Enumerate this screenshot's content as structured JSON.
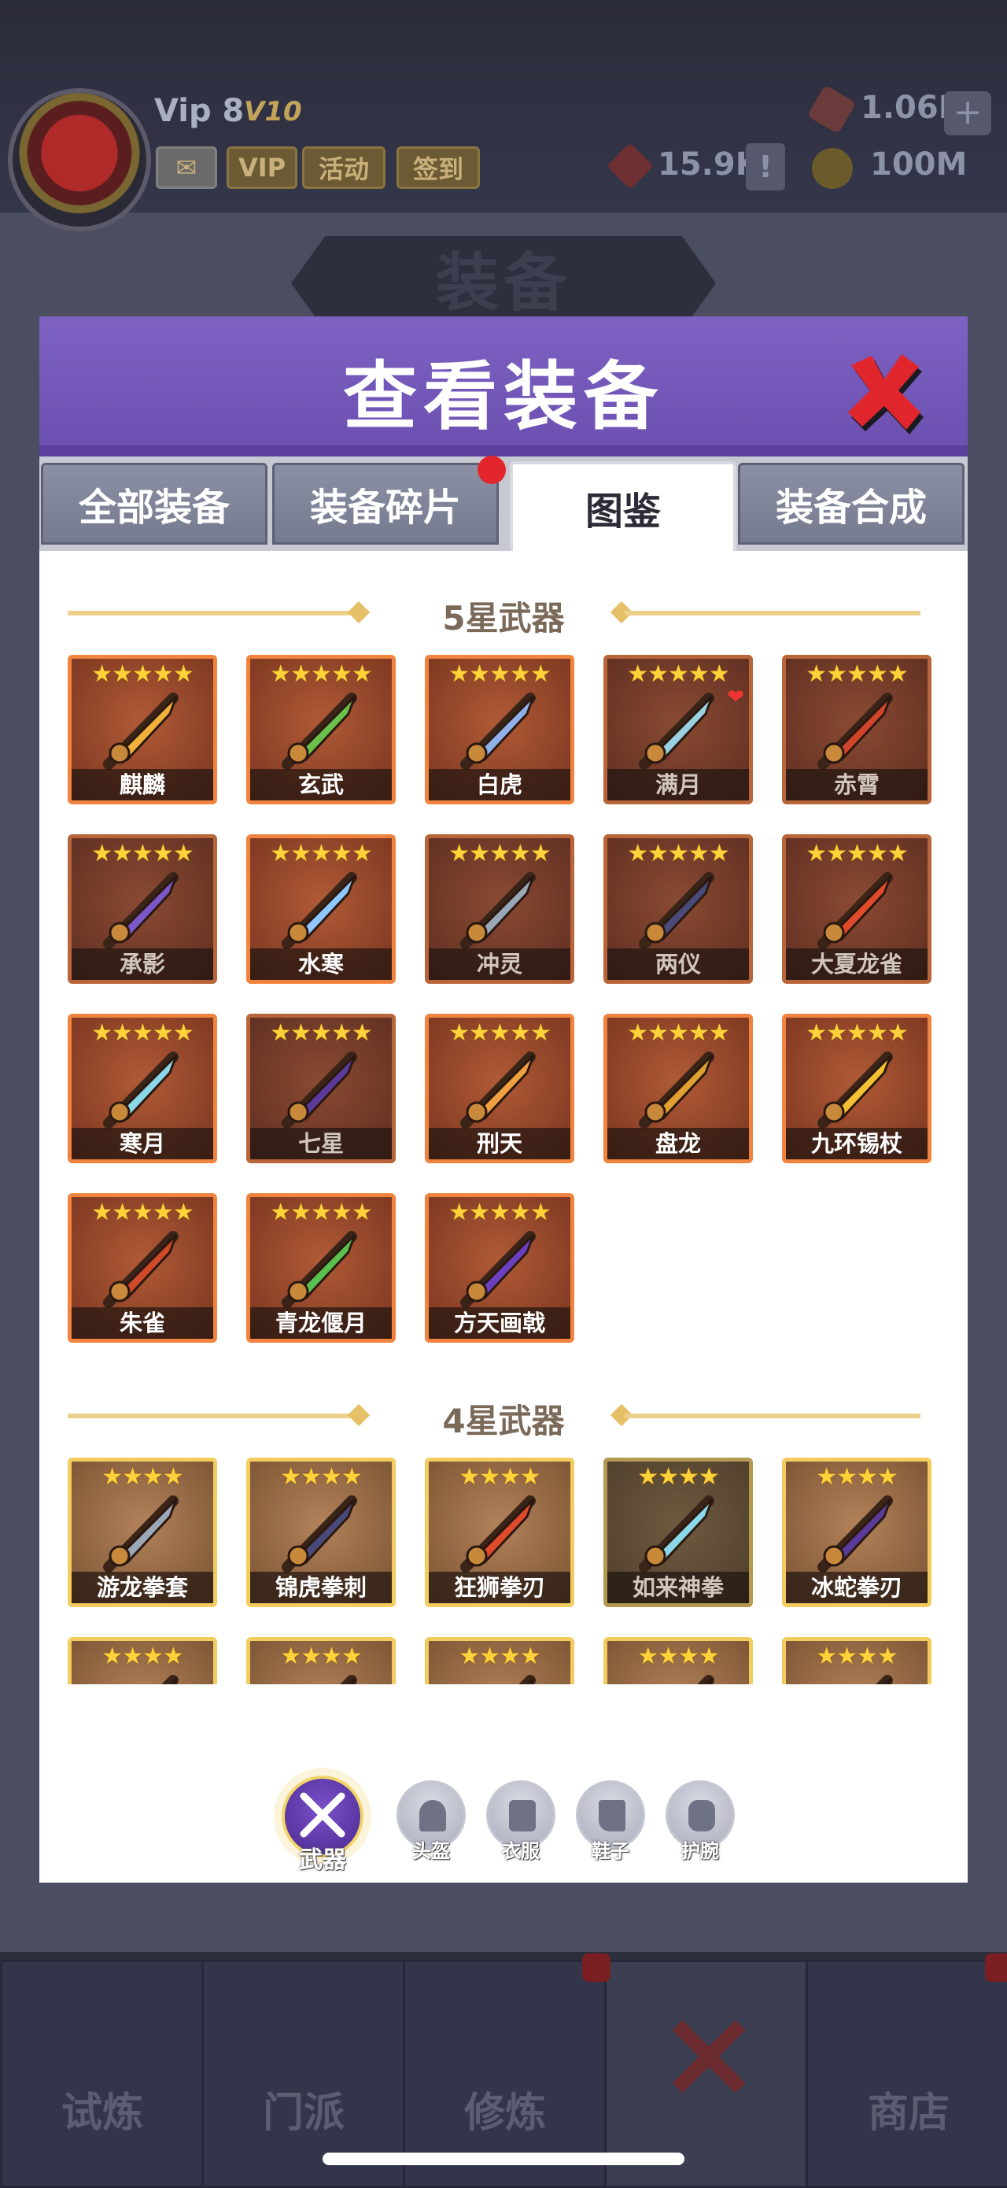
{
  "header": {
    "vip_label": "Vip 8",
    "vip_badge": "V10",
    "buttons": [
      "VIP",
      "活动",
      "签到"
    ],
    "resources": {
      "gems": "1.06K",
      "tokens": "15.9K",
      "gold": "100M"
    },
    "plus": "+",
    "alert": "!"
  },
  "page_title": "装备",
  "modal": {
    "title": "查看装备",
    "tabs": [
      {
        "label": "全部装备",
        "active": false
      },
      {
        "label": "装备碎片",
        "active": false,
        "badge": true
      },
      {
        "label": "图鉴",
        "active": true
      },
      {
        "label": "装备合成",
        "active": false
      }
    ],
    "sections": [
      {
        "title": "5星武器",
        "stars": "★★★★★",
        "items": [
          {
            "name": "麒麟",
            "icon": "qilin-weapon-icon"
          },
          {
            "name": "玄武",
            "icon": "xuanwu-weapon-icon"
          },
          {
            "name": "白虎",
            "icon": "baihu-weapon-icon"
          },
          {
            "name": "满月",
            "icon": "full-moon-weapon-icon",
            "dim": true,
            "heart": true
          },
          {
            "name": "赤霄",
            "icon": "chixiao-sword-icon",
            "dim": true
          },
          {
            "name": "承影",
            "icon": "chengying-sword-icon",
            "dim": true
          },
          {
            "name": "水寒",
            "icon": "shuihan-sword-icon"
          },
          {
            "name": "冲灵",
            "icon": "chongling-sword-icon",
            "dim": true
          },
          {
            "name": "两仪",
            "icon": "liangyi-sword-icon",
            "dim": true
          },
          {
            "name": "大夏龙雀",
            "icon": "daxia-longque-blade-icon",
            "dim": true
          },
          {
            "name": "寒月",
            "icon": "hanyue-blade-icon"
          },
          {
            "name": "七星",
            "icon": "qixing-blade-icon",
            "dim": true
          },
          {
            "name": "刑天",
            "icon": "xingtian-axe-icon"
          },
          {
            "name": "盘龙",
            "icon": "panlong-staff-icon"
          },
          {
            "name": "九环锡杖",
            "icon": "nine-ring-staff-icon"
          },
          {
            "name": "朱雀",
            "icon": "zhuque-spear-icon"
          },
          {
            "name": "青龙偃月",
            "icon": "qinglong-glaive-icon"
          },
          {
            "name": "方天画戟",
            "icon": "fangtian-halberd-icon"
          }
        ]
      },
      {
        "title": "4星武器",
        "stars": "★★★★",
        "items": [
          {
            "name": "游龙拳套",
            "icon": "youlong-gauntlet-icon"
          },
          {
            "name": "锦虎拳刺",
            "icon": "jinhu-knuckle-icon"
          },
          {
            "name": "狂狮拳刃",
            "icon": "kuangshi-fist-blade-icon"
          },
          {
            "name": "如来神拳",
            "icon": "rulai-fist-icon",
            "dim": true
          },
          {
            "name": "冰蛇拳刃",
            "icon": "bingshe-claw-icon"
          },
          {
            "name": "",
            "icon": "weapon-icon"
          },
          {
            "name": "",
            "icon": "weapon-icon"
          },
          {
            "name": "",
            "icon": "weapon-icon"
          },
          {
            "name": "",
            "icon": "weapon-icon"
          },
          {
            "name": "",
            "icon": "weapon-icon"
          }
        ]
      }
    ],
    "categories": [
      {
        "label": "武器",
        "icon": "crossed-swords-icon",
        "active": true
      },
      {
        "label": "头盔",
        "icon": "helmet-icon"
      },
      {
        "label": "衣服",
        "icon": "clothes-icon"
      },
      {
        "label": "鞋子",
        "icon": "boots-icon"
      },
      {
        "label": "护腕",
        "icon": "bracer-icon"
      }
    ]
  },
  "bottom_nav": [
    {
      "label": "试炼"
    },
    {
      "label": "门派"
    },
    {
      "label": "修炼"
    },
    {
      "label": ""
    },
    {
      "label": "商店"
    }
  ],
  "colors": {
    "accent": "#6a4fb0",
    "five_star_border": "#f0843e",
    "four_star_border": "#f2cc5e",
    "star": "#ffd23a"
  }
}
